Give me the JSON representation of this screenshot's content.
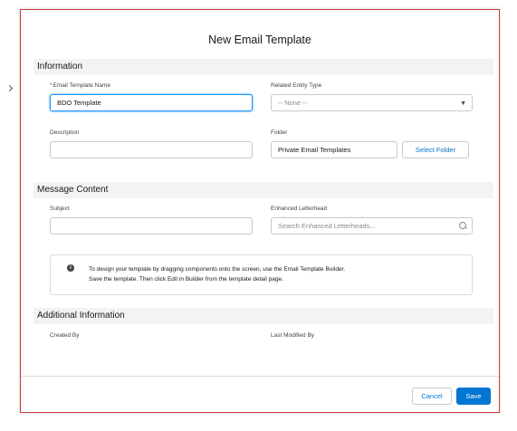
{
  "modal": {
    "title": "New Email Template"
  },
  "sections": {
    "information": "Information",
    "message_content": "Message Content",
    "additional_information": "Additional Information"
  },
  "fields": {
    "template_name": {
      "required_mark": "*",
      "label": "Email Template Name",
      "value": "BDO Template"
    },
    "related_entity": {
      "label": "Related Entity Type",
      "value": "-- None --"
    },
    "description": {
      "label": "Description",
      "value": ""
    },
    "folder": {
      "label": "Folder",
      "value": "Private Email Templates",
      "button": "Select Folder"
    },
    "subject": {
      "label": "Subject",
      "value": ""
    },
    "letterhead": {
      "label": "Enhanced Letterhead",
      "placeholder": "Search Enhanced Letterheads..."
    }
  },
  "info_message": {
    "line1": "To design your template by dragging components onto the screen, use the Email Template Builder.",
    "line2": "Save the template. Then click Edit in Builder from the template detail page."
  },
  "additional": {
    "created_by": "Created By",
    "last_modified_by": "Last Modified By"
  },
  "footer": {
    "cancel": "Cancel",
    "save": "Save"
  },
  "colors": {
    "brand": "#0176d3",
    "frame_border": "#c23934",
    "focus": "#1b96ff"
  },
  "icons": {
    "info": "info-icon",
    "dropdown": "chevron-down-icon",
    "search": "search-icon"
  }
}
